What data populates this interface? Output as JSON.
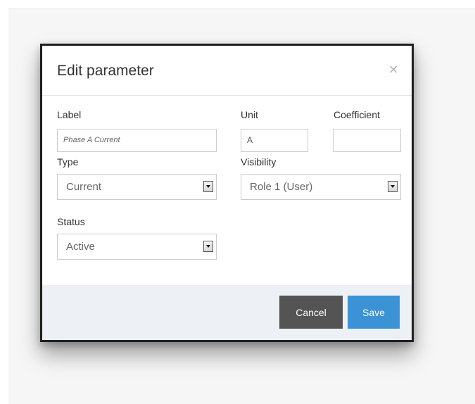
{
  "dialog": {
    "title": "Edit parameter",
    "close_symbol": "×"
  },
  "form": {
    "label": {
      "caption": "Label",
      "value": "Phase A Current"
    },
    "unit": {
      "caption": "Unit",
      "value": "A"
    },
    "coefficient": {
      "caption": "Coefficient",
      "value": ""
    },
    "type": {
      "caption": "Type",
      "selected": "Current"
    },
    "visibility": {
      "caption": "Visibility",
      "selected": "Role 1 (User)"
    },
    "status": {
      "caption": "Status",
      "selected": "Active"
    }
  },
  "footer": {
    "cancel_label": "Cancel",
    "save_label": "Save"
  },
  "icons": {
    "close": "close-icon",
    "dropdown": "chevron-down-icon"
  },
  "colors": {
    "save": "#3b93d6",
    "cancel": "#545454",
    "footer_bg": "#edf1f6"
  }
}
